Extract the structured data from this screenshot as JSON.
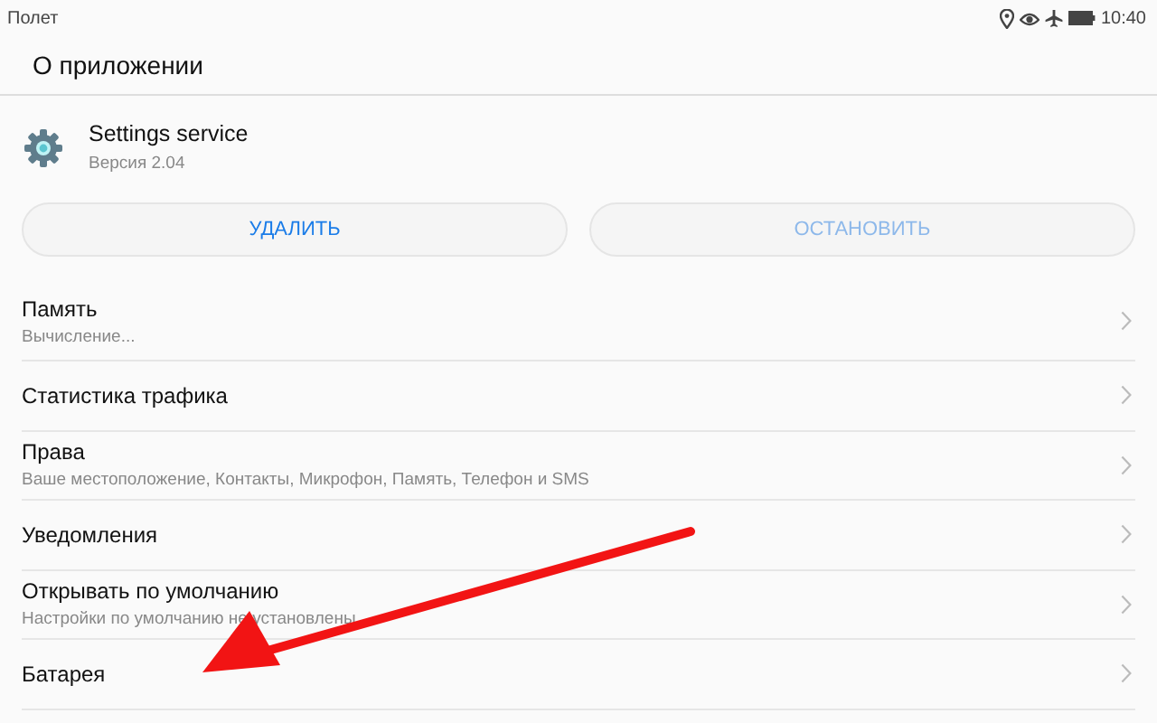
{
  "status_bar": {
    "label": "Полет",
    "time": "10:40"
  },
  "header": {
    "title": "О приложении"
  },
  "app": {
    "name": "Settings service",
    "version": "Версия 2.04"
  },
  "buttons": [
    {
      "label": "УДАЛИТЬ",
      "disabled": false
    },
    {
      "label": "ОСТАНОВИТЬ",
      "disabled": true
    }
  ],
  "items": [
    {
      "title": "Память",
      "subtitle": "Вычисление..."
    },
    {
      "title": "Статистика трафика"
    },
    {
      "title": "Права",
      "subtitle": "Ваше местоположение, Контакты, Микрофон, Память, Телефон и SMS"
    },
    {
      "title": "Уведомления"
    },
    {
      "title": "Открывать по умолчанию",
      "subtitle": "Настройки по умолчанию не установлены"
    },
    {
      "title": "Батарея"
    }
  ]
}
